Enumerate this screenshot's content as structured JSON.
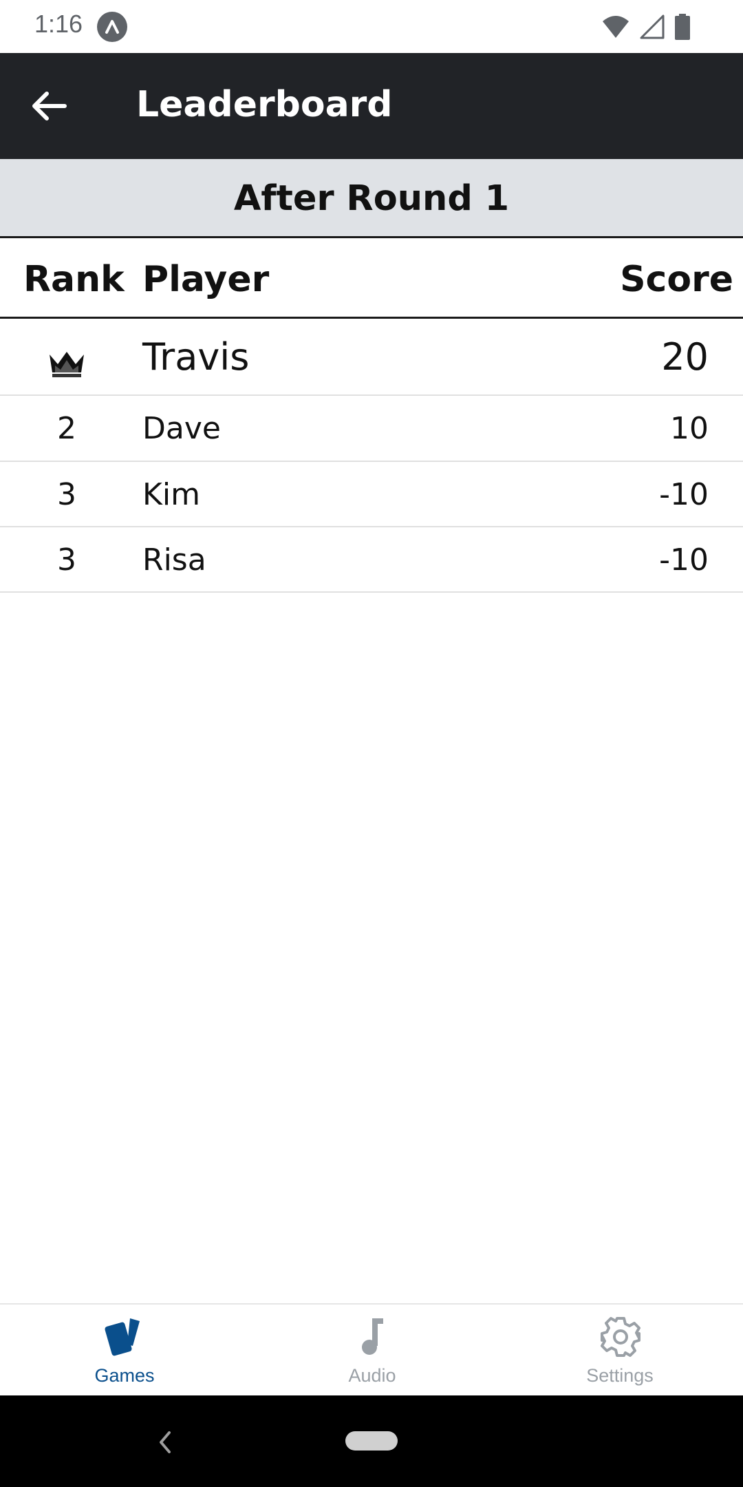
{
  "status_bar": {
    "time": "1:16",
    "icons": [
      "app-notification-icon",
      "wifi-icon",
      "signal-icon",
      "battery-icon"
    ]
  },
  "app_bar": {
    "title": "Leaderboard",
    "back_icon": "arrow-left-icon"
  },
  "round_header": {
    "title": "After Round 1"
  },
  "table": {
    "headers": {
      "rank": "Rank",
      "player": "Player",
      "score": "Score"
    },
    "rows": [
      {
        "rank": "1",
        "rank_icon": "crown-icon",
        "player": "Travis",
        "score": "20"
      },
      {
        "rank": "2",
        "player": "Dave",
        "score": "10"
      },
      {
        "rank": "3",
        "player": "Kim",
        "score": "-10"
      },
      {
        "rank": "3",
        "player": "Risa",
        "score": "-10"
      }
    ]
  },
  "bottom_nav": {
    "items": [
      {
        "label": "Games",
        "icon": "cards-icon",
        "active": true
      },
      {
        "label": "Audio",
        "icon": "music-note-icon",
        "active": false
      },
      {
        "label": "Settings",
        "icon": "gear-icon",
        "active": false
      }
    ]
  },
  "colors": {
    "app_bar": "#212327",
    "round_header_bg": "#dfe2e6",
    "active_nav": "#0a4f8c",
    "inactive_nav": "#9aa0a6"
  }
}
